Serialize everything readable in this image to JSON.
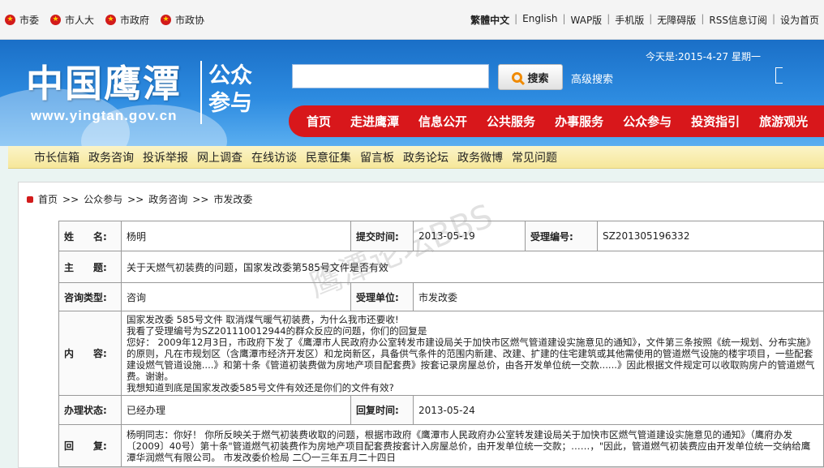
{
  "top_links_left": [
    "市委",
    "市人大",
    "市政府",
    "市政协"
  ],
  "top_links_right": [
    "繁體中文",
    "English",
    "WAP版",
    "手机版",
    "无障碍版",
    "RSS信息订阅",
    "设为首页"
  ],
  "header": {
    "logo_text": "中国鹰潭",
    "logo_url": "www.yingtan.gov.cn",
    "logo_sub": "公众参与",
    "search_placeholder": "",
    "search_button": "搜索",
    "advanced_search": "高级搜索",
    "date": "今天是:2015-4-27 星期一"
  },
  "main_nav": [
    "首页",
    "走进鹰潭",
    "信息公开",
    "公共服务",
    "办事服务",
    "公众参与",
    "投资指引",
    "旅游观光"
  ],
  "sub_nav": [
    "市长信箱",
    "政务咨询",
    "投诉举报",
    "网上调查",
    "在线访谈",
    "民意征集",
    "留言板",
    "政务论坛",
    "政务微博",
    "常见问题"
  ],
  "breadcrumb": [
    "首页",
    "公众参与",
    "政务咨询",
    "市发改委"
  ],
  "breadcrumb_sep": ">>",
  "watermark": "鹰潭论坛BBS",
  "record": {
    "name_label": "姓　　名:",
    "name": "杨明",
    "submit_label": "提交时间:",
    "submit_time": "2013-05-19",
    "accept_no_label": "受理编号:",
    "accept_no": "SZ201305196332",
    "subject_label": "主　　题:",
    "subject": "关于天燃气初装费的问题，国家发改委第585号文件是否有效",
    "type_label": "咨询类型:",
    "type": "咨询",
    "unit_label": "受理单位:",
    "unit": "市发改委",
    "content_label": "内　　容:",
    "content_lines": [
      "国家发改委 585号文件 取消煤气暖气初装费，为什么我市还要收!",
      "我看了受理编号为SZ201110012944的群众反应的问题，你们的回复是",
      "您好：  2009年12月3日，市政府下发了《鹰潭市人民政府办公室转发市建设局关于加快市区燃气管道建设实施意见的通知》，文件第三条按照《统一规划、分布实施》的原则，凡在市规划区（含鹰潭市经济开发区）和龙岗新区，具备供气条件的范围内新建、改建、扩建的住宅建筑或其他需使用的管道燃气设施的楼宇项目，一些配套建设燃气管道设施....》和第十条《管道初装费做为房地产项目配套费》按套记录房屋总价，由各开发单位统一交款......》因此根据文件规定可以收取购房户的管道燃气费。谢谢。",
      "我想知道到底是国家发改委585号文件有效还是你们的文件有效?"
    ],
    "status_label": "办理状态:",
    "status": "已经办理",
    "reply_time_label": "回复时间:",
    "reply_time": "2013-05-24",
    "reply_label": "回　　复:",
    "reply": "杨明同志：你好！  你所反映关于燃气初装费收取的问题，根据市政府《鹰潭市人民政府办公室转发建设局关于加快市区燃气管道建设实施意见的通知》（鹰府办发〔2009〕40号）第十条\"管道燃气初装费作为房地产项目配套费按套计入房屋总价，由开发单位统一交款；……，\"因此，管道燃气初装费应由开发单位统一交纳给鹰潭华润燃气有限公司。  市发改委价检局  二〇一三年五月二十四日"
  },
  "colors": {
    "nav_red": "#d8171b",
    "header_blue": "#2d8be0",
    "subnav_yellow": "#f6e79a"
  }
}
